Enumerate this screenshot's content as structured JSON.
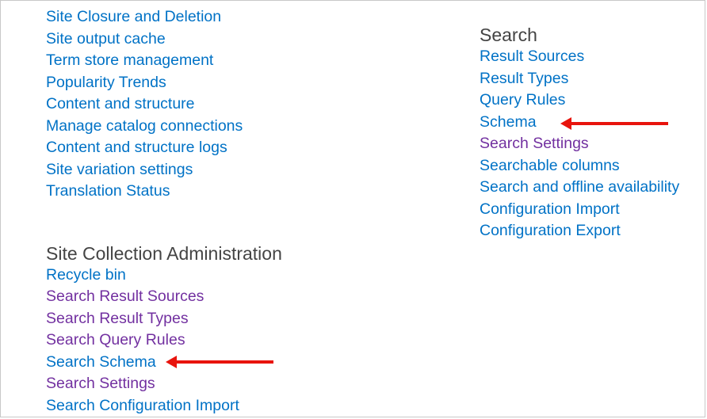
{
  "left": {
    "site_links": [
      {
        "label": "Site Closure and Deletion",
        "visited": false
      },
      {
        "label": "Site output cache",
        "visited": false
      },
      {
        "label": "Term store management",
        "visited": false
      },
      {
        "label": "Popularity Trends",
        "visited": false
      },
      {
        "label": "Content and structure",
        "visited": false
      },
      {
        "label": "Manage catalog connections",
        "visited": false
      },
      {
        "label": "Content and structure logs",
        "visited": false
      },
      {
        "label": "Site variation settings",
        "visited": false
      },
      {
        "label": "Translation Status",
        "visited": false
      }
    ],
    "collection_heading": "Site Collection Administration",
    "collection_links": [
      {
        "label": "Recycle bin",
        "visited": false
      },
      {
        "label": "Search Result Sources",
        "visited": true
      },
      {
        "label": "Search Result Types",
        "visited": true
      },
      {
        "label": "Search Query Rules",
        "visited": true
      },
      {
        "label": "Search Schema",
        "visited": false
      },
      {
        "label": "Search Settings",
        "visited": true
      },
      {
        "label": "Search Configuration Import",
        "visited": false
      }
    ]
  },
  "right": {
    "search_heading": "Search",
    "search_links": [
      {
        "label": "Result Sources",
        "visited": false
      },
      {
        "label": "Result Types",
        "visited": false
      },
      {
        "label": "Query Rules",
        "visited": false
      },
      {
        "label": "Schema",
        "visited": false
      },
      {
        "label": "Search Settings",
        "visited": true
      },
      {
        "label": "Searchable columns",
        "visited": false
      },
      {
        "label": "Search and offline availability",
        "visited": false
      },
      {
        "label": "Configuration Import",
        "visited": false
      },
      {
        "label": "Configuration Export",
        "visited": false
      }
    ]
  },
  "colors": {
    "link": "#0072c6",
    "visited_link": "#7230a0",
    "heading": "#444444",
    "arrow": "#e8140d"
  },
  "annotations": {
    "arrow_icon": "red-arrow-left-icon"
  }
}
